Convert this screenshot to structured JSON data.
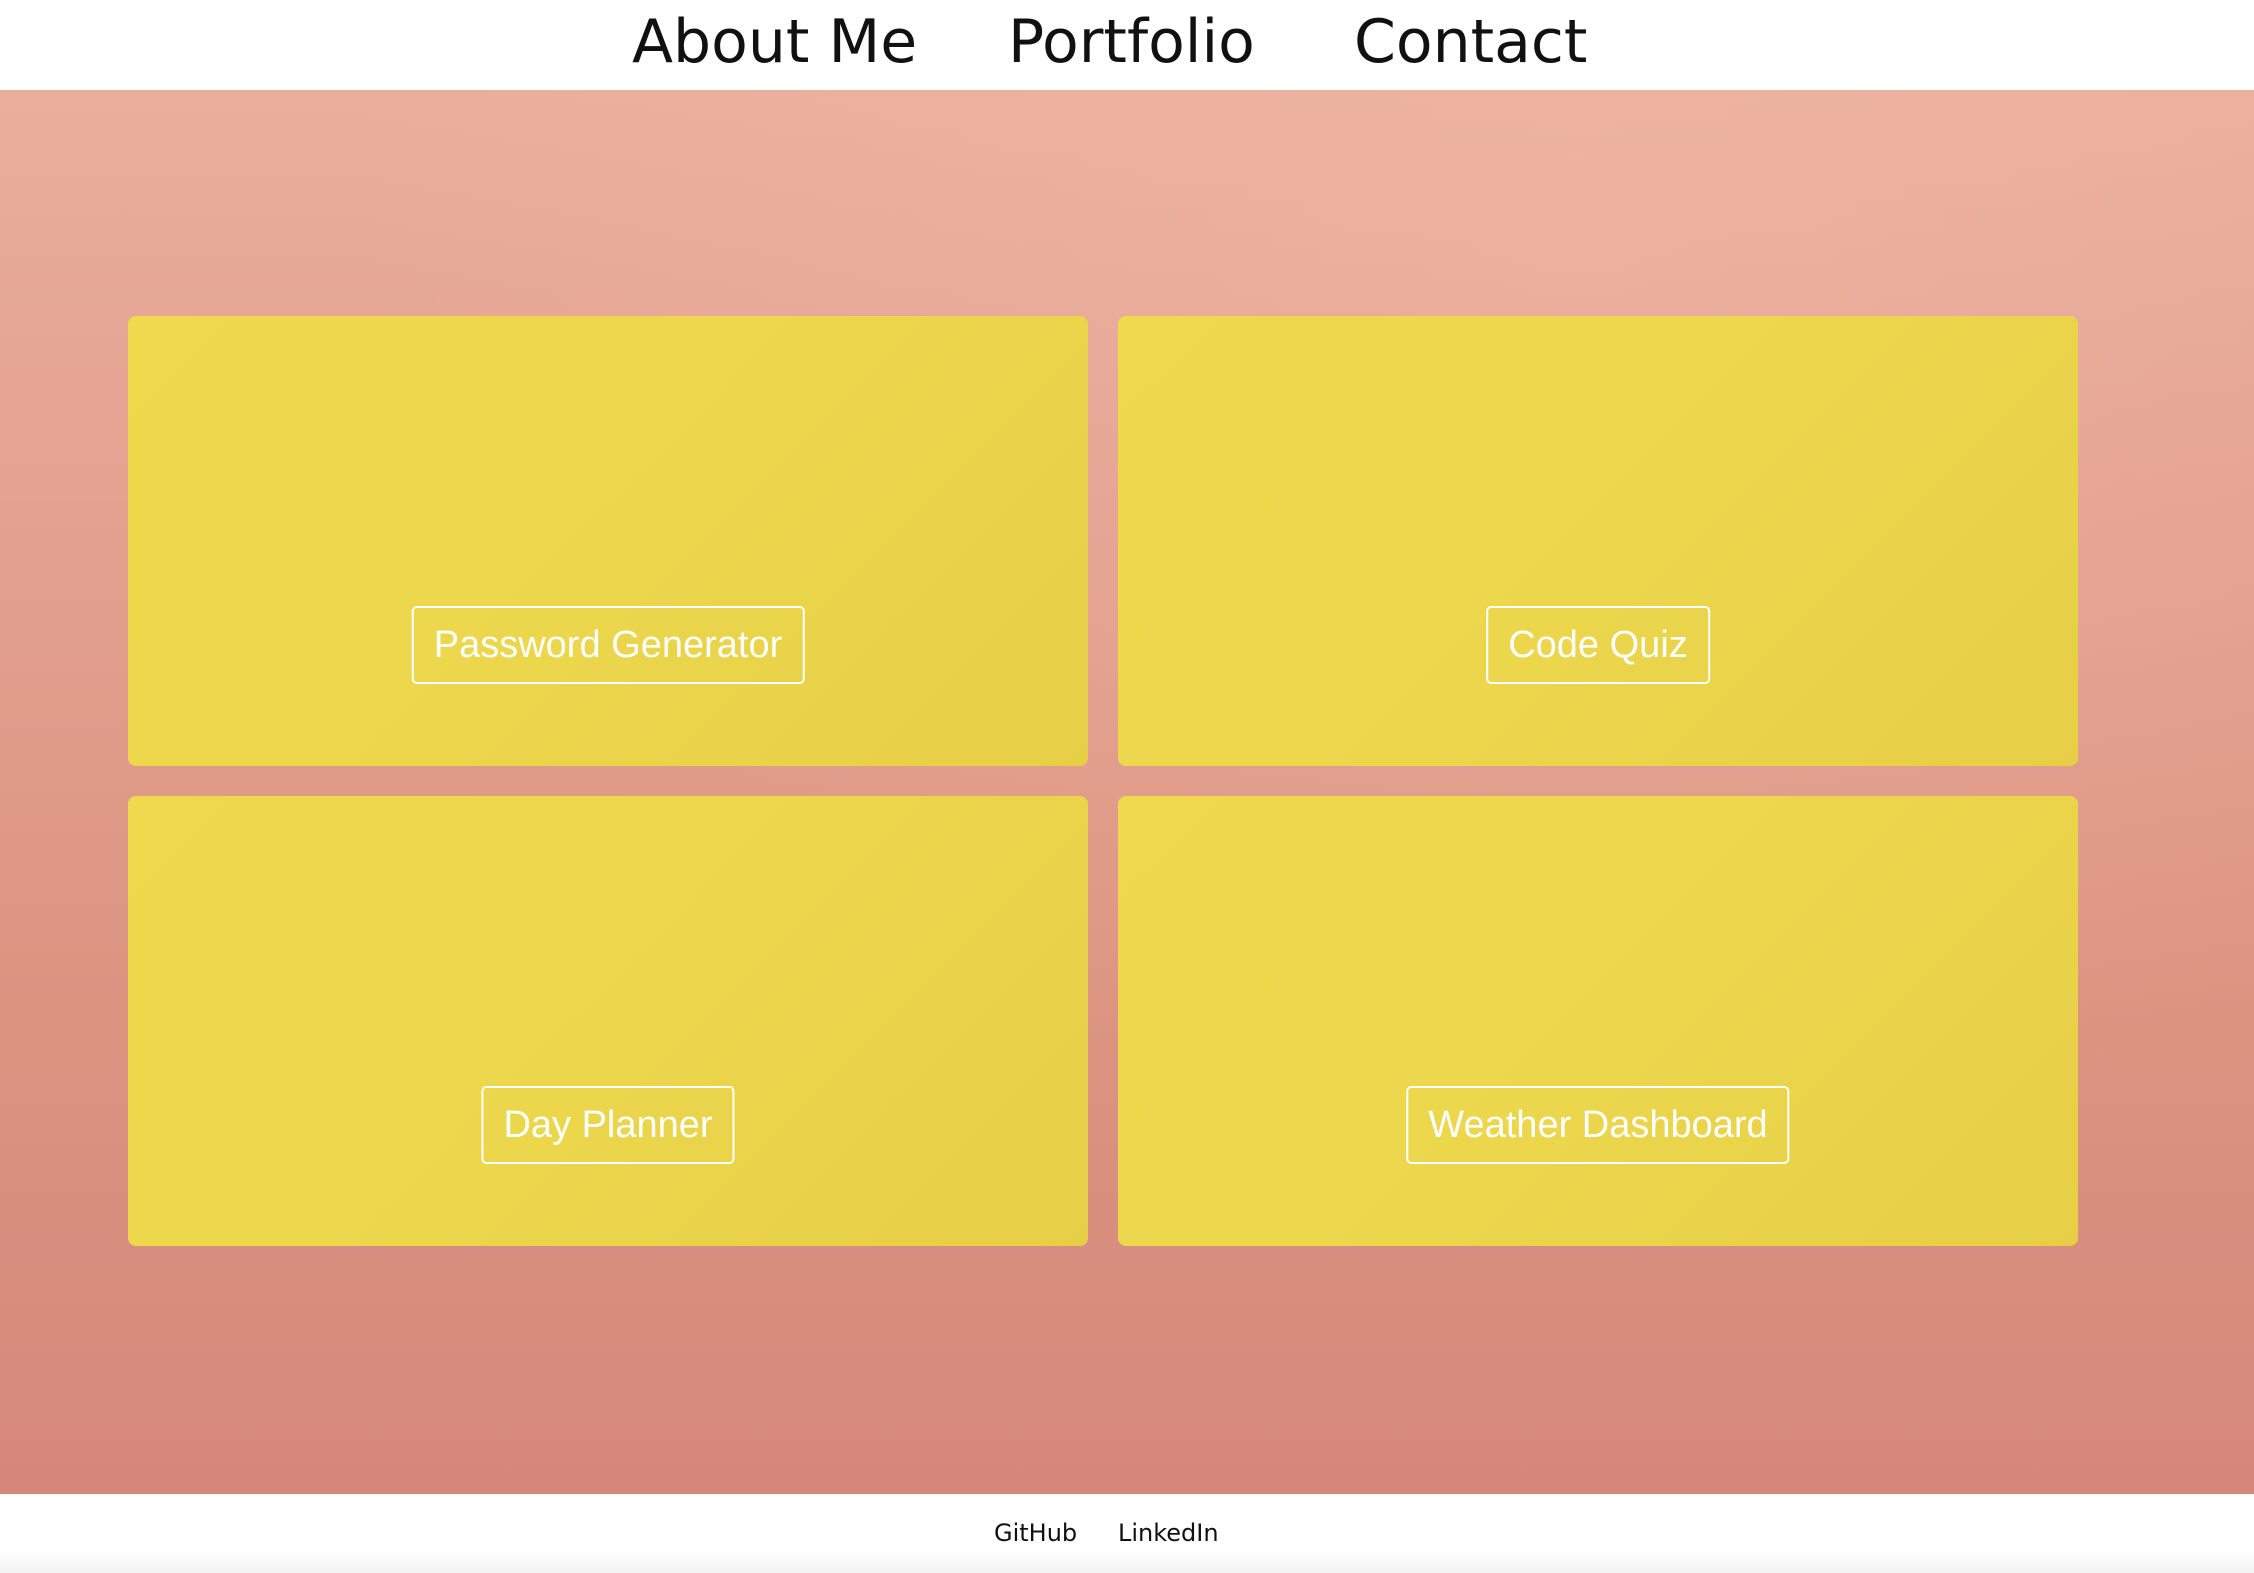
{
  "nav": {
    "items": [
      {
        "label": "About Me"
      },
      {
        "label": "Portfolio"
      },
      {
        "label": "Contact"
      }
    ]
  },
  "projects": [
    {
      "label": "Password Generator"
    },
    {
      "label": "Code Quiz"
    },
    {
      "label": "Day Planner"
    },
    {
      "label": "Weather Dashboard"
    }
  ],
  "footer": {
    "links": [
      {
        "label": "GitHub"
      },
      {
        "label": "LinkedIn"
      }
    ]
  },
  "colors": {
    "card_yellow": "#ecd64b",
    "background_coral": "#e09a88",
    "button_border": "#ffffff",
    "text_dark": "#111111"
  }
}
